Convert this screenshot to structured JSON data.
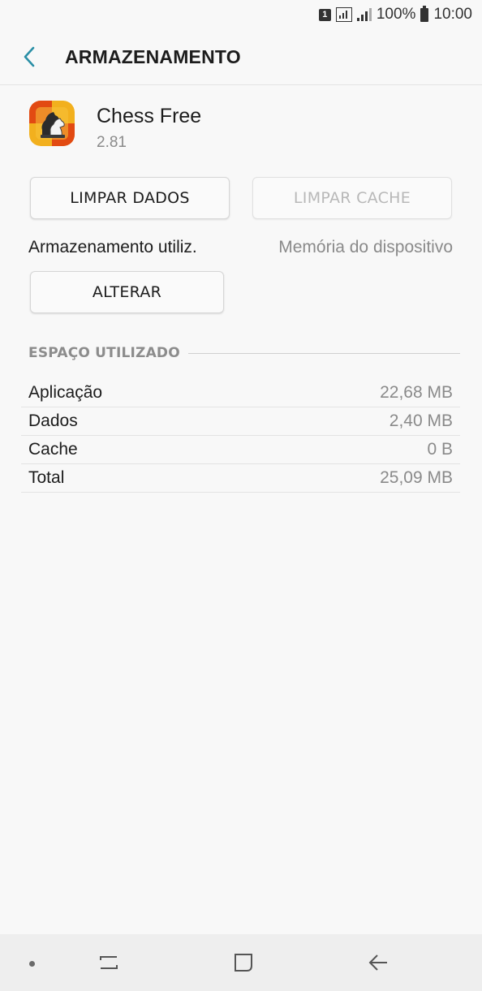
{
  "status_bar": {
    "sim": "1",
    "battery": "100%",
    "time": "10:00"
  },
  "header": {
    "title": "ARMAZENAMENTO",
    "back_icon": "chevron-left-icon"
  },
  "app": {
    "name": "Chess Free",
    "version": "2.81"
  },
  "buttons": {
    "clear_data": "LIMPAR DADOS",
    "clear_cache": "LIMPAR CACHE",
    "change": "ALTERAR"
  },
  "storage": {
    "label": "Armazenamento utiliz.",
    "value": "Memória do dispositivo"
  },
  "section": {
    "title": "ESPAÇO UTILIZADO"
  },
  "usage": [
    {
      "label": "Aplicação",
      "value": "22,68 MB"
    },
    {
      "label": "Dados",
      "value": "2,40 MB"
    },
    {
      "label": "Cache",
      "value": "0 B"
    },
    {
      "label": "Total",
      "value": "25,09 MB"
    }
  ],
  "colors": {
    "accent": "#2a8fa6",
    "background": "#f8f8f8",
    "secondary_text": "#8a8a8a",
    "disabled_text": "#b8b8b8"
  }
}
